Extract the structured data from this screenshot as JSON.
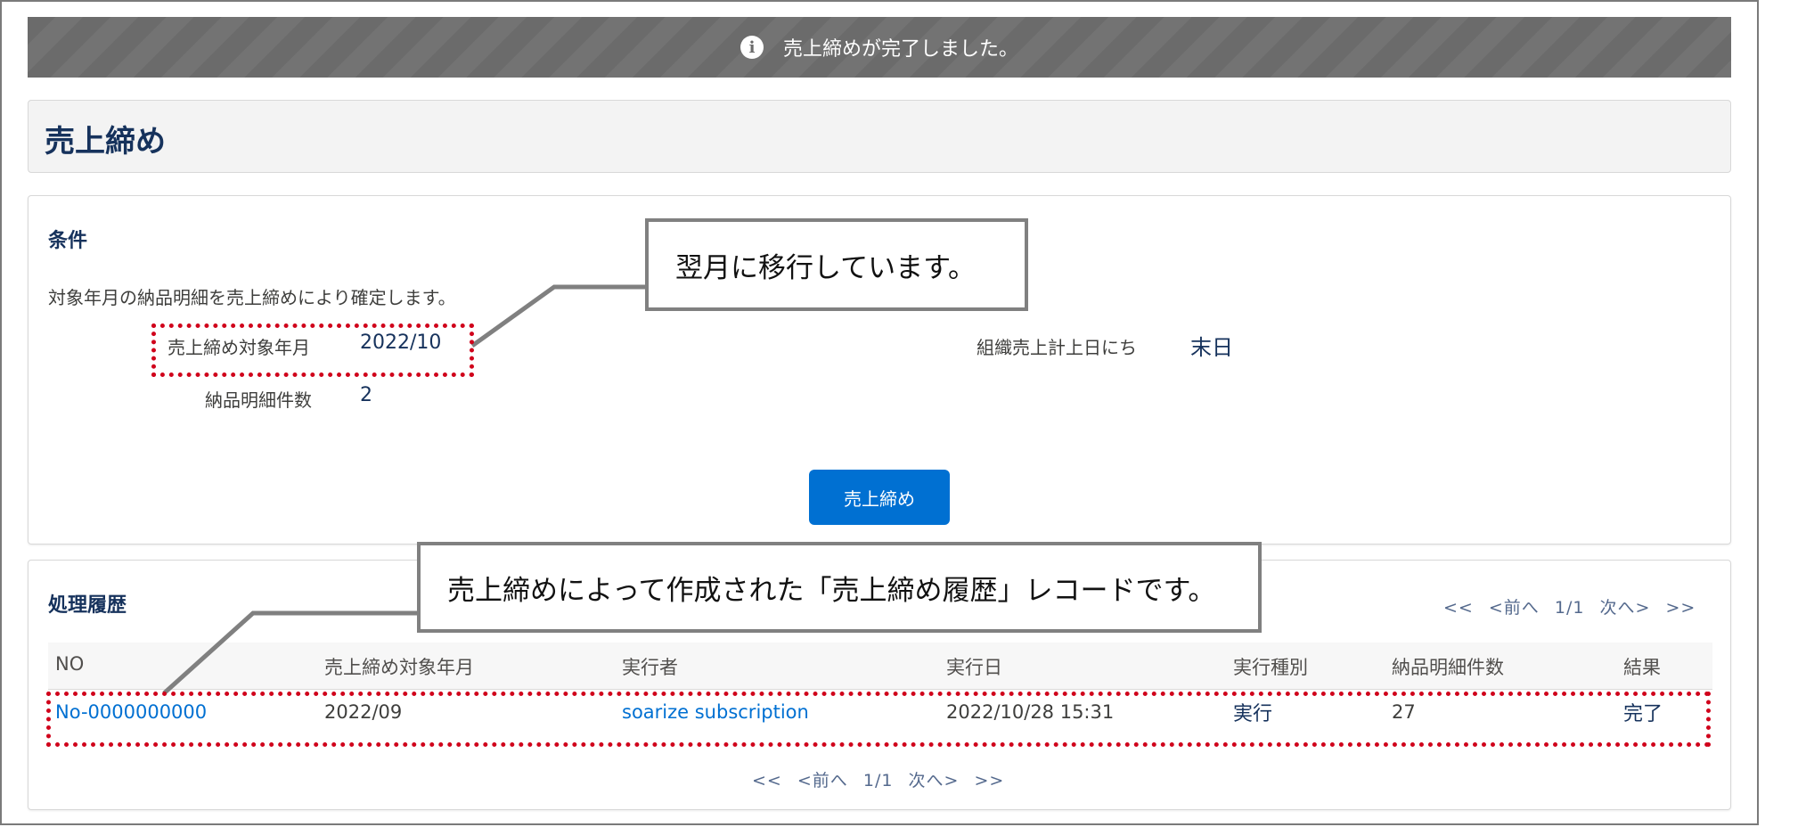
{
  "toast": {
    "icon": "info-icon",
    "message": "売上締めが完了しました。"
  },
  "page": {
    "title": "売上締め"
  },
  "conditions": {
    "title": "条件",
    "description": "対象年月の納品明細を売上締めにより確定します。",
    "target_month_label": "売上締め対象年月",
    "target_month_value": "2022/10",
    "detail_count_label": "納品明細件数",
    "detail_count_value": "2",
    "org_sales_day_label": "組織売上計上日にち",
    "org_sales_day_value": "末日",
    "close_button": "売上締め"
  },
  "history": {
    "title": "処理履歴",
    "pager_top": {
      "first": "<<",
      "prev": "<前へ",
      "page": "1/1",
      "next": "次へ>",
      "last": ">>"
    },
    "columns": [
      "NO",
      "売上締め対象年月",
      "実行者",
      "実行日",
      "実行種別",
      "納品明細件数",
      "結果"
    ],
    "rows": [
      [
        "No-0000000000",
        "2022/09",
        "soarize subscription",
        "2022/10/28 15:31",
        "実行",
        "27",
        "完了"
      ]
    ],
    "pager_bottom": {
      "first": "<<",
      "prev": "<前へ",
      "page": "1/1",
      "next": "次へ>",
      "last": ">>"
    }
  },
  "annotations": {
    "callout_1": "翌月に移行しています。",
    "callout_2": "売上締めによって作成された「売上締め履歴」レコードです。",
    "highlight_color": "#d0021b"
  },
  "colors": {
    "brand_button": "#0070d2",
    "link": "#0070d2",
    "heading": "#16325c",
    "toast_bg": "#6b6b6b"
  }
}
